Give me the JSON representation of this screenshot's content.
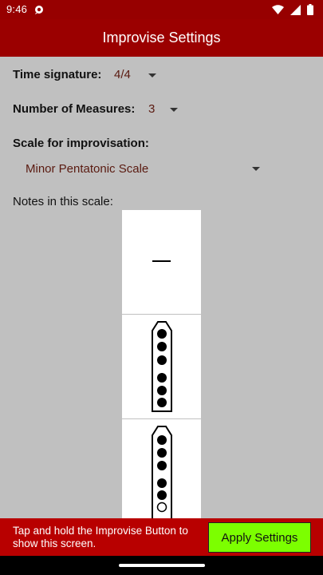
{
  "status_bar": {
    "time": "9:46",
    "icons": [
      "chat-bubble-icon",
      "wifi-icon",
      "signal-icon",
      "battery-icon"
    ]
  },
  "app_bar": {
    "title": "Improvise Settings"
  },
  "settings": {
    "time_signature": {
      "label": "Time signature:",
      "value": "4/4"
    },
    "measures": {
      "label": "Number of Measures:",
      "value": "3"
    },
    "scale": {
      "label": "Scale for improvisation:",
      "value": "Minor Pentatonic Scale"
    }
  },
  "notes": {
    "label": "Notes in this scale:",
    "cells": [
      {
        "kind": "rest"
      },
      {
        "kind": "flute",
        "holes": [
          1,
          1,
          1,
          1,
          1,
          1
        ],
        "extra_open": false
      },
      {
        "kind": "flute",
        "holes": [
          1,
          1,
          1,
          1,
          1,
          0
        ],
        "extra_open": true
      }
    ]
  },
  "footer": {
    "hint": "Tap and hold the Improvise Button to show this screen.",
    "apply_label": "Apply Settings"
  },
  "colors": {
    "app_bar": "#9b0000",
    "bottom_bar": "#b80000",
    "apply_button": "#7cff00",
    "content_bg": "#c0c0c0"
  }
}
